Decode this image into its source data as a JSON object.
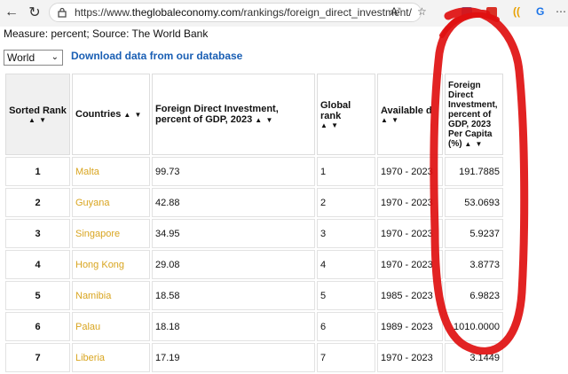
{
  "browser": {
    "url_prefix": "https://www.",
    "url_domain": "theglobaleconomy.com",
    "url_path": "/rankings/foreign_direct_investment/"
  },
  "page": {
    "measure_text": "Measure: percent; Source: The World Bank",
    "region_select": "World",
    "download_link": "Download data from our database"
  },
  "table": {
    "headers": {
      "rank": "Sorted Rank",
      "country": "Countries",
      "fdi": "Foreign Direct Investment, percent of GDP, 2023",
      "global": "Global rank",
      "available": "Available d",
      "pc": "Foreign Direct Investment, percent of GDP, 2023 Per Capita (%)"
    },
    "sort_arrows": "▲ ▼",
    "rows": [
      {
        "rank": "1",
        "country": "Malta",
        "fdi": "99.73",
        "global": "1",
        "available": "1970 - 2023",
        "pc": "191.7885"
      },
      {
        "rank": "2",
        "country": "Guyana",
        "fdi": "42.88",
        "global": "2",
        "available": "1970 - 2023",
        "pc": "53.0693"
      },
      {
        "rank": "3",
        "country": "Singapore",
        "fdi": "34.95",
        "global": "3",
        "available": "1970 - 2023",
        "pc": "5.9237"
      },
      {
        "rank": "4",
        "country": "Hong Kong",
        "fdi": "29.08",
        "global": "4",
        "available": "1970 - 2023",
        "pc": "3.8773"
      },
      {
        "rank": "5",
        "country": "Namibia",
        "fdi": "18.58",
        "global": "5",
        "available": "1985 - 2023",
        "pc": "6.9823"
      },
      {
        "rank": "6",
        "country": "Palau",
        "fdi": "18.18",
        "global": "6",
        "available": "1989 - 2023",
        "pc": "1010.0000"
      },
      {
        "rank": "7",
        "country": "Liberia",
        "fdi": "17.19",
        "global": "7",
        "available": "1970 - 2023",
        "pc": "3.1449"
      }
    ]
  },
  "colors": {
    "country_link": "#d9a520",
    "download_link": "#1a5fb4",
    "annotation": "#e01010"
  }
}
